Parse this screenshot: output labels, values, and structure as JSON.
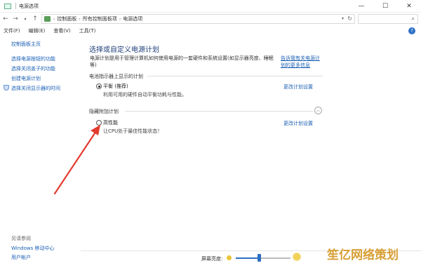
{
  "window": {
    "title": "电源选项",
    "controls": [
      "—",
      "☐",
      "✕"
    ]
  },
  "address": {
    "crumbs": [
      "控制面板",
      "所有控制面板项",
      "电源选项"
    ],
    "search_placeholder": ""
  },
  "menu": [
    "文件(F)",
    "编辑(E)",
    "查看(V)",
    "工具(T)"
  ],
  "sidebar": {
    "home": "控制面板主页",
    "items": [
      "选择电源按钮的功能",
      "选择关闭盖子的功能",
      "创建电源计划",
      "选择关闭显示器的时间"
    ],
    "see_also_label": "另请参阅",
    "see_also": [
      "Windows 移动中心",
      "用户帐户"
    ]
  },
  "main": {
    "title": "选择或自定义电源计划",
    "description": "电源计划是用于管理计算机如何使用电源的一套硬件和系统设置(如显示器亮度、睡眠等)",
    "learn_more": "告诉我有关电源计划的更多信息",
    "group1_label": "电池指示器上显示的计划",
    "plan1_name": "平衡 (推荐)",
    "plan1_desc": "利用可用的硬件自动平衡功耗与性能。",
    "plan1_change": "更改计划设置",
    "group2_label": "隐藏附加计划",
    "plan2_name": "高性能",
    "plan2_desc": "让CPU处于最佳性能状态！",
    "plan2_change": "更改计划设置"
  },
  "bottom": {
    "brightness_label": "屏幕亮度:",
    "brightness_level": 0.42
  },
  "watermark": "笙亿网络策划",
  "colors": {
    "link": "#1a5fb4",
    "arrow": "#e23b2e",
    "accent": "#2d6fc4"
  }
}
